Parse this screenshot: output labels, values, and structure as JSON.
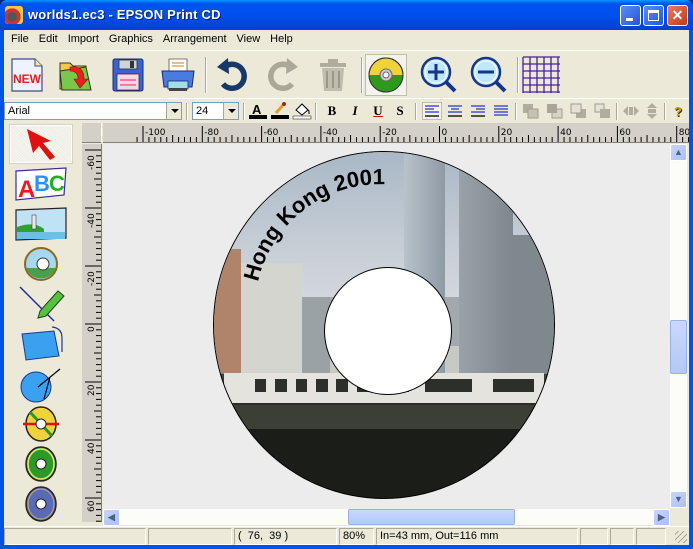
{
  "window": {
    "title": "worlds1.ec3 - EPSON Print CD",
    "controls": {
      "minimize": "minimize",
      "maximize": "maximize",
      "close": "✕"
    }
  },
  "menubar": {
    "items": [
      {
        "label": "File"
      },
      {
        "label": "Edit"
      },
      {
        "label": "Import"
      },
      {
        "label": "Graphics"
      },
      {
        "label": "Arrangement"
      },
      {
        "label": "View"
      },
      {
        "label": "Help"
      }
    ]
  },
  "toolbar": {
    "buttons": [
      {
        "name": "new",
        "icon": "new-document-icon",
        "label": "NEW"
      },
      {
        "name": "open",
        "icon": "open-folder-icon"
      },
      {
        "name": "save",
        "icon": "floppy-save-icon"
      },
      {
        "name": "print",
        "icon": "printer-icon"
      },
      {
        "name": "undo",
        "icon": "undo-arrow-icon"
      },
      {
        "name": "redo",
        "icon": "redo-arrow-icon",
        "disabled": true
      },
      {
        "name": "delete",
        "icon": "trash-can-icon",
        "disabled": true
      },
      {
        "name": "cd-view",
        "icon": "cd-disc-icon",
        "active": true
      },
      {
        "name": "zoom-in",
        "icon": "zoom-in-icon"
      },
      {
        "name": "zoom-out",
        "icon": "zoom-out-icon"
      },
      {
        "name": "grid",
        "icon": "grid-icon"
      }
    ]
  },
  "format_toolbar": {
    "font_family": "Arial",
    "font_size": "24",
    "text_color_glyph": "A",
    "bold": "B",
    "italic": "I",
    "underline": "U",
    "shadow": "S",
    "align_buttons": [
      "align-left",
      "align-center",
      "align-right",
      "align-justify"
    ],
    "arrange_buttons": [
      "bring-to-front",
      "send-to-back",
      "bring-forward",
      "send-backward"
    ],
    "flip_buttons": [
      "flip-horizontal",
      "flip-vertical"
    ],
    "help_glyph": "?"
  },
  "left_tools": [
    {
      "name": "select",
      "icon": "select-arrow-icon",
      "selected": true
    },
    {
      "name": "text",
      "icon": "abc-text-icon",
      "label": "ABC"
    },
    {
      "name": "image",
      "icon": "picture-icon"
    },
    {
      "name": "background-image",
      "icon": "cd-picture-icon"
    },
    {
      "name": "line",
      "icon": "line-pencil-icon"
    },
    {
      "name": "rectangle",
      "icon": "rectangle-icon"
    },
    {
      "name": "circle",
      "icon": "circle-compass-icon"
    },
    {
      "name": "cd-size",
      "icon": "cd-size-icon"
    },
    {
      "name": "cd-color",
      "icon": "cd-green-icon"
    },
    {
      "name": "cd-blue",
      "icon": "cd-blue-icon"
    }
  ],
  "rulers": {
    "horizontal_labels": [
      "-100",
      "-80",
      "-60",
      "-40",
      "-20",
      "0",
      "20",
      "40",
      "60",
      "80"
    ],
    "vertical_labels": [
      "-60",
      "-40",
      "-20",
      "0",
      "20",
      "40",
      "60"
    ]
  },
  "canvas": {
    "disc_text": "Hong Kong 2001",
    "colors": {
      "background": "#ececec",
      "hole": "#ffffff",
      "text": "#000000"
    }
  },
  "statusbar": {
    "cells": [
      "",
      "",
      "(  76,  39 )",
      "80%",
      "In=43 mm, Out=116 mm",
      "",
      "",
      ""
    ]
  }
}
